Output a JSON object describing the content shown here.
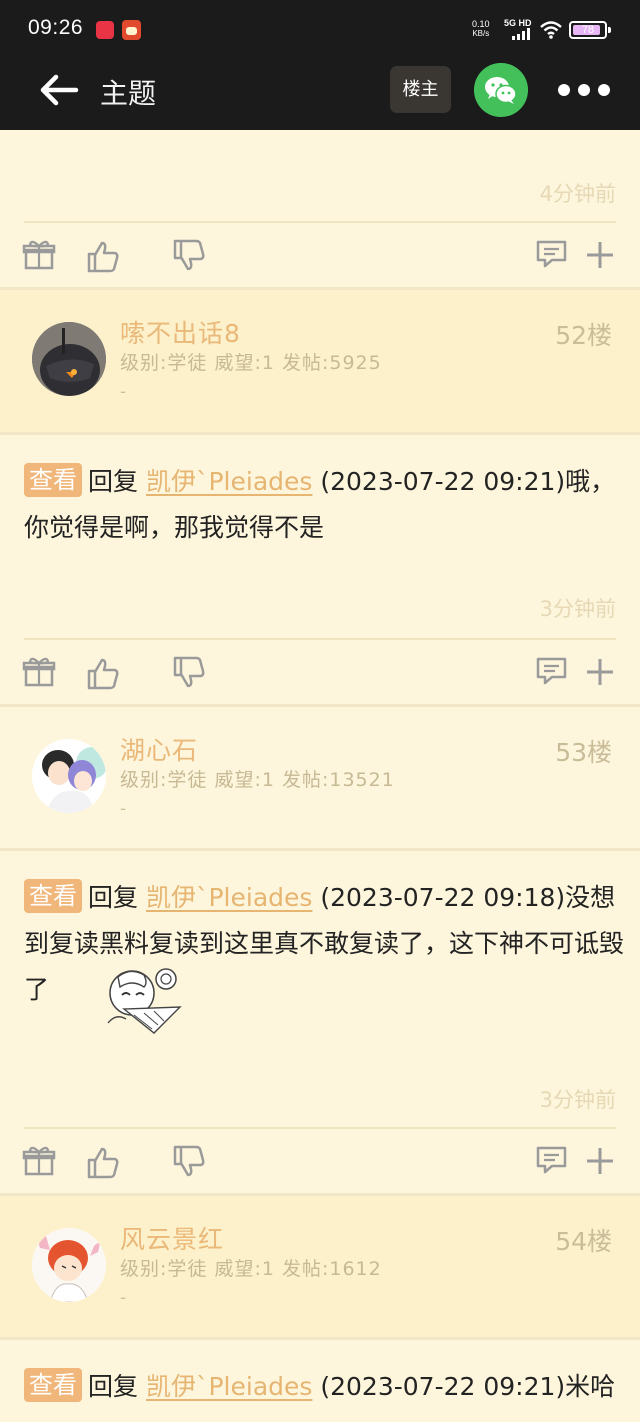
{
  "status_bar": {
    "time": "09:26",
    "speed_value": "0.10",
    "speed_unit": "KB/s",
    "network": "5G HD",
    "battery": "78",
    "battery_level": 0.78
  },
  "app_bar": {
    "title": "主题",
    "op_label": "楼主",
    "icons": [
      "back-arrow-icon",
      "wechat-icon",
      "more-icon"
    ]
  },
  "posts": [
    {
      "time": "4分钟前"
    },
    {
      "username": "嗦不出话8",
      "info": "级别:学徒 威望:1 发帖:5925",
      "signature": "-",
      "floor": "52楼",
      "view_tag": "查看",
      "reply_prefix": "回复",
      "reply_user": "凯伊`Pleiades",
      "reply_text": " (2023-07-22 09:21)哦，你觉得是啊，那我觉得不是",
      "time": "3分钟前"
    },
    {
      "username": "湖心石",
      "info": "级别:学徒 威望:1 发帖:13521",
      "signature": "-",
      "floor": "53楼",
      "view_tag": "查看",
      "reply_prefix": "回复",
      "reply_user": "凯伊`Pleiades",
      "reply_text": " (2023-07-22 09:18)没想到复读黑料复读到这里真不敢复读了，这下神不可诋毁了",
      "time": "3分钟前"
    },
    {
      "username": "风云景红",
      "info": "级别:学徒 威望:1 发帖:1612",
      "signature": "-",
      "floor": "54楼",
      "view_tag": "查看",
      "reply_prefix": "回复",
      "reply_user": "凯伊`Pleiades",
      "reply_text": " (2023-07-22 09:21)米哈"
    }
  ],
  "colors": {
    "accent": "#eab878",
    "tag": "#f0b67a",
    "bar": "#1b1b1b",
    "wechat": "#43c05a",
    "background": "#fdf6dc"
  }
}
